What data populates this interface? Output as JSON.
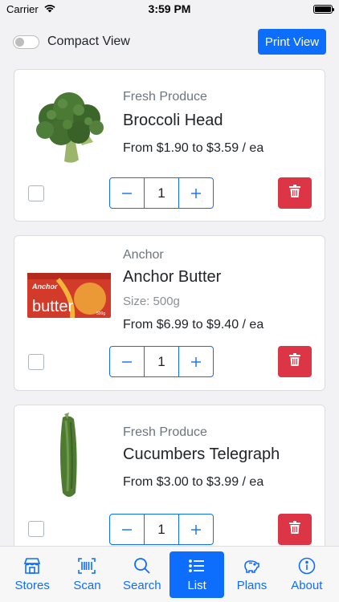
{
  "status_bar": {
    "carrier": "Carrier",
    "time": "3:59 PM"
  },
  "topbar": {
    "compact_view_label": "Compact View",
    "compact_view_enabled": false,
    "print_view_label": "Print View"
  },
  "items": [
    {
      "brand": "Fresh Produce",
      "name": "Broccoli Head",
      "size": "",
      "price": "From $1.90 to $3.59 / ea",
      "quantity": "1",
      "image": "broccoli-image"
    },
    {
      "brand": "Anchor",
      "name": "Anchor Butter",
      "size": "Size: 500g",
      "price": "From $6.99 to $9.40 / ea",
      "quantity": "1",
      "image": "butter-image",
      "package_text": {
        "logo": "Anchor",
        "product": "butter",
        "weight": "500g"
      }
    },
    {
      "brand": "Fresh Produce",
      "name": "Cucumbers Telegraph",
      "size": "",
      "price": "From $3.00 to $3.99 / ea",
      "quantity": "1",
      "image": "cucumber-image"
    }
  ],
  "tabbar": {
    "tabs": [
      {
        "label": "Stores",
        "icon": "store-icon"
      },
      {
        "label": "Scan",
        "icon": "barcode-icon"
      },
      {
        "label": "Search",
        "icon": "search-icon"
      },
      {
        "label": "List",
        "icon": "list-icon",
        "active": true
      },
      {
        "label": "Plans",
        "icon": "piggy-bank-icon"
      },
      {
        "label": "About",
        "icon": "info-icon"
      }
    ]
  },
  "colors": {
    "primary": "#0d6efd",
    "danger": "#dc3545",
    "background": "#f2f2f4"
  }
}
